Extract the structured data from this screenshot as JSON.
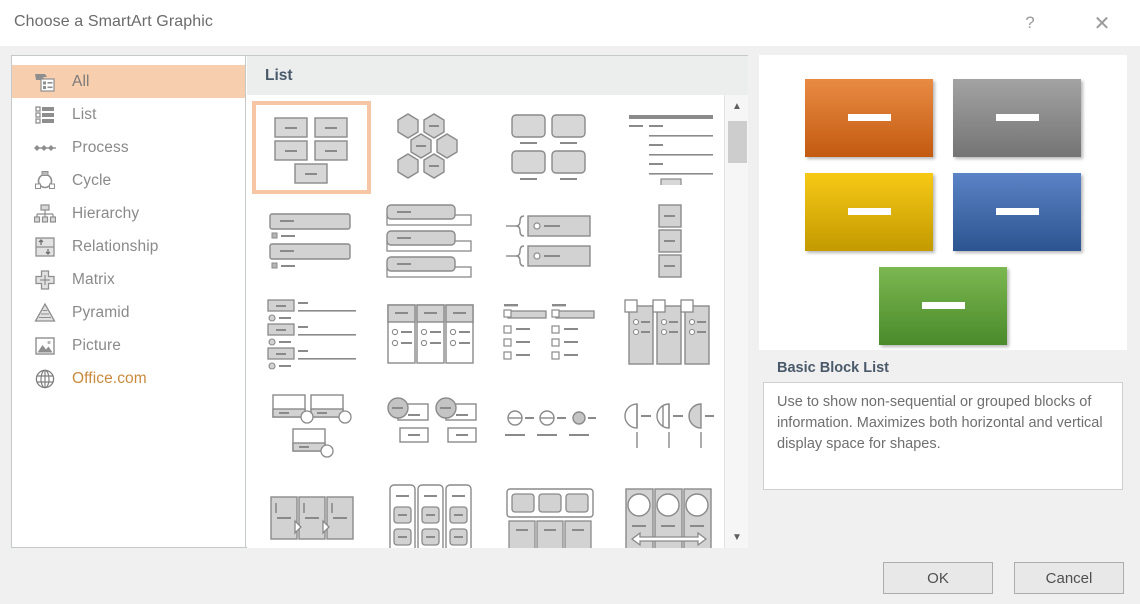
{
  "dialog": {
    "title": "Choose a SmartArt Graphic",
    "help_icon": "question-mark-icon",
    "close_icon": "close-icon"
  },
  "sidebar": {
    "items": [
      {
        "label": "All",
        "icon": "all-smartart-icon",
        "selected": true
      },
      {
        "label": "List",
        "icon": "list-icon",
        "selected": false
      },
      {
        "label": "Process",
        "icon": "process-icon",
        "selected": false
      },
      {
        "label": "Cycle",
        "icon": "cycle-icon",
        "selected": false
      },
      {
        "label": "Hierarchy",
        "icon": "hierarchy-icon",
        "selected": false
      },
      {
        "label": "Relationship",
        "icon": "relationship-icon",
        "selected": false
      },
      {
        "label": "Matrix",
        "icon": "matrix-icon",
        "selected": false
      },
      {
        "label": "Pyramid",
        "icon": "pyramid-icon",
        "selected": false
      },
      {
        "label": "Picture",
        "icon": "picture-icon",
        "selected": false
      },
      {
        "label": "Office.com",
        "icon": "globe-icon",
        "selected": false
      }
    ],
    "selected_highlight_color": "#f7cfaf"
  },
  "gallery": {
    "group_header": "List",
    "selected_index": 0,
    "selection_border_color": "#f7c6a4",
    "thumbnails": [
      {
        "shape": "basic-block-list"
      },
      {
        "shape": "alternating-hexagons"
      },
      {
        "shape": "picture-caption-list"
      },
      {
        "shape": "lined-list"
      },
      {
        "shape": "vertical-bullet-list"
      },
      {
        "shape": "vertical-box-list"
      },
      {
        "shape": "vertical-bracket-list"
      },
      {
        "shape": "vertical-chevron-list"
      },
      {
        "shape": "vertical-arrow-list"
      },
      {
        "shape": "trapezoid-list"
      },
      {
        "shape": "horizontal-picture-list"
      },
      {
        "shape": "stacked-list"
      },
      {
        "shape": "grouped-list"
      },
      {
        "shape": "horizontal-bullet-list"
      },
      {
        "shape": "square-accent-list"
      },
      {
        "shape": "pie-process"
      },
      {
        "shape": "detailed-process"
      },
      {
        "shape": "vertical-block-list"
      },
      {
        "shape": "tab-list"
      },
      {
        "shape": "horizontal-arrow-list"
      }
    ],
    "scrollbar": {
      "up_icon": "chevron-up-icon",
      "down_icon": "chevron-down-icon"
    }
  },
  "preview": {
    "name": "Basic Block List",
    "description": "Use to show non-sequential or grouped blocks of information. Maximizes both horizontal and vertical display space for shapes.",
    "blocks": [
      {
        "name": "block-orange",
        "color_top": "#e98b43",
        "color_bottom": "#c35a11"
      },
      {
        "name": "block-gray",
        "color_top": "#9e9e9e",
        "color_bottom": "#777777"
      },
      {
        "name": "block-yellow",
        "color_top": "#f5c613",
        "color_bottom": "#c79a00"
      },
      {
        "name": "block-blue",
        "color_top": "#5a82c4",
        "color_bottom": "#2d528f"
      },
      {
        "name": "block-green",
        "color_top": "#77b44f",
        "color_bottom": "#4b8b2c"
      }
    ]
  },
  "footer": {
    "ok_label": "OK",
    "cancel_label": "Cancel"
  }
}
